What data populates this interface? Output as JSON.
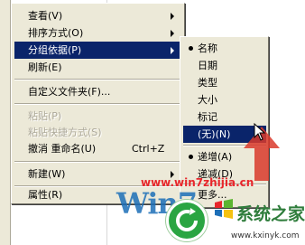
{
  "context_menu": {
    "items": [
      {
        "label": "查看(V)"
      },
      {
        "label": "排序方式(O)"
      },
      {
        "label": "分组依据(P)"
      },
      {
        "label": "刷新(E)"
      },
      {
        "label": "自定义文件夹(F)..."
      },
      {
        "label": "粘贴(P)"
      },
      {
        "label": "粘贴快捷方式(S)"
      },
      {
        "label": "撤消 重命名(U)",
        "shortcut": "Ctrl+Z"
      },
      {
        "label": "新建(W)"
      },
      {
        "label": "属性(R)"
      }
    ]
  },
  "group_submenu": {
    "items": [
      {
        "label": "名称"
      },
      {
        "label": "日期"
      },
      {
        "label": "类型"
      },
      {
        "label": "大小"
      },
      {
        "label": "标记"
      },
      {
        "label": "(无)(N)"
      },
      {
        "label": "递增(A)"
      },
      {
        "label": "递减(D)"
      },
      {
        "label": "更多..."
      }
    ]
  },
  "watermark": {
    "url": "www.win7zhijia.cn",
    "big_text": "Win7",
    "brand": "系统之家",
    "site": "www.kxinyk.com"
  },
  "colors": {
    "menu_bg": "#ece9d8",
    "highlight": "#0a246a",
    "disabled": "#aca899",
    "arrow_red": "#d93a2b"
  }
}
